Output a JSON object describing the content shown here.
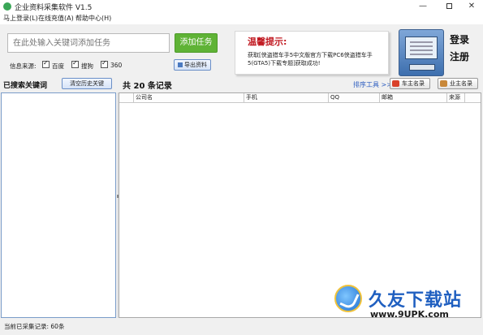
{
  "window": {
    "title": "企业资料采集软件 V1.5",
    "minimize": "—",
    "close": "✕"
  },
  "menu": [
    {
      "label": "马上登录(L)"
    },
    {
      "label": "在线充值(A)"
    },
    {
      "label": "帮助中心(H)"
    }
  ],
  "search": {
    "placeholder": "在此处输入关键词添加任务",
    "add_task_label": "添加任务"
  },
  "sources": {
    "label": "信息来源:",
    "options": [
      {
        "label": "百度",
        "checked": true
      },
      {
        "label": "搜狗",
        "checked": true
      },
      {
        "label": "360",
        "checked": true
      }
    ]
  },
  "export_label": "导出资料",
  "notice": {
    "title": "温馨提示:",
    "body": "获取[侠盗猎车手5中文版官方下载PC6侠盗猎车手5(GTA5)下载专题]获取成功!"
  },
  "account": {
    "login": "登录",
    "register": "注册"
  },
  "keywords": {
    "header": "已搜索关键词",
    "clear_label": "清空历史关键"
  },
  "records": {
    "count_text": "共 20 条记录",
    "sort_tool": "排序工具 >>",
    "car_owner_btn": "车主名录",
    "business_owner_btn": "业主名录",
    "columns": [
      "",
      "公司名",
      "手机",
      "QQ",
      "邮箱",
      "来源"
    ]
  },
  "watermark": {
    "title": "久友下载站",
    "url": "www.9UPK.com"
  },
  "status": "当前已采集记录: 60条",
  "colors": {
    "add_task": "#5fb336",
    "notice_title": "#c0171f",
    "link": "#2a5bbf",
    "watermark": "#1f5fc0"
  }
}
